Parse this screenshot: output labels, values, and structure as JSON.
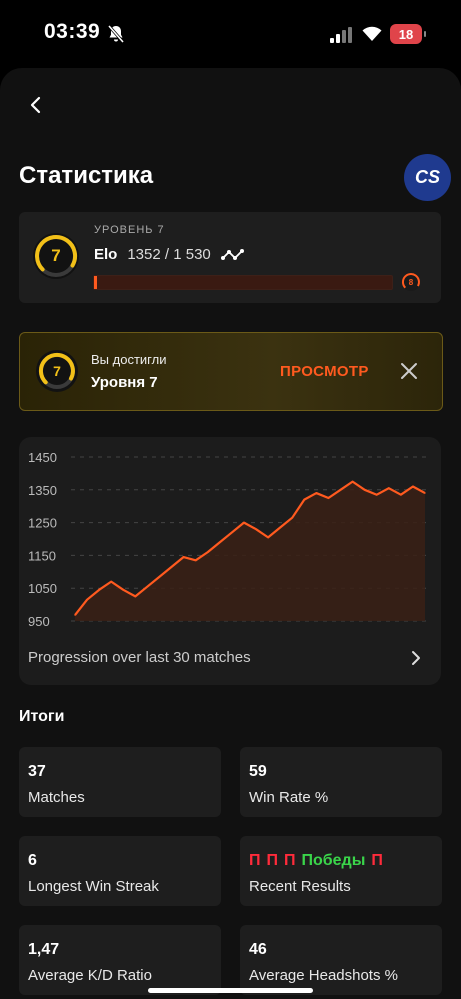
{
  "status_bar": {
    "time": "03:39",
    "battery": "18"
  },
  "header": {
    "title": "Статистика",
    "game_logo": "CS"
  },
  "level_card": {
    "level_label": "УРОВЕНЬ 7",
    "level_number": "7",
    "elo_label": "Elo",
    "elo_value": "1352 / 1 530",
    "progress_fraction": 0.01,
    "next_level": "8"
  },
  "banner": {
    "level_number": "7",
    "small_text": "Вы достигли",
    "big_text": "Уровня 7",
    "view_label": "ПРОСМОТР"
  },
  "chart_data": {
    "type": "line",
    "ylim": [
      950,
      1450
    ],
    "yticks": [
      "1450",
      "1350",
      "1250",
      "1150",
      "1050",
      "950"
    ],
    "x": [
      1,
      2,
      3,
      4,
      5,
      6,
      7,
      8,
      9,
      10,
      11,
      12,
      13,
      14,
      15,
      16,
      17,
      18,
      19,
      20,
      21,
      22,
      23,
      24,
      25,
      26,
      27,
      28,
      29,
      30
    ],
    "values": [
      968,
      1015,
      1045,
      1070,
      1045,
      1025,
      1055,
      1085,
      1115,
      1145,
      1135,
      1160,
      1190,
      1220,
      1250,
      1230,
      1205,
      1235,
      1265,
      1320,
      1340,
      1325,
      1350,
      1375,
      1350,
      1335,
      1355,
      1335,
      1360,
      1340
    ],
    "line_color": "#ff5a1f"
  },
  "chart_caption": "Progression over last 30 matches",
  "summary": {
    "title": "Итоги",
    "stats": [
      {
        "value": "37",
        "label": "Matches"
      },
      {
        "value": "59",
        "label": "Win Rate %"
      },
      {
        "value": "6",
        "label": "Longest Win Streak"
      },
      {
        "value": "",
        "label": "Recent Results"
      },
      {
        "value": "1,47",
        "label": "Average K/D Ratio"
      },
      {
        "value": "46",
        "label": "Average Headshots %"
      }
    ],
    "recent_results": [
      "П",
      "П",
      "П",
      "Победы",
      "П"
    ]
  },
  "colors": {
    "accent": "#ff5a1f",
    "level": "#f2c018",
    "win": "#3ad54a",
    "loss": "#ff2b3b"
  }
}
